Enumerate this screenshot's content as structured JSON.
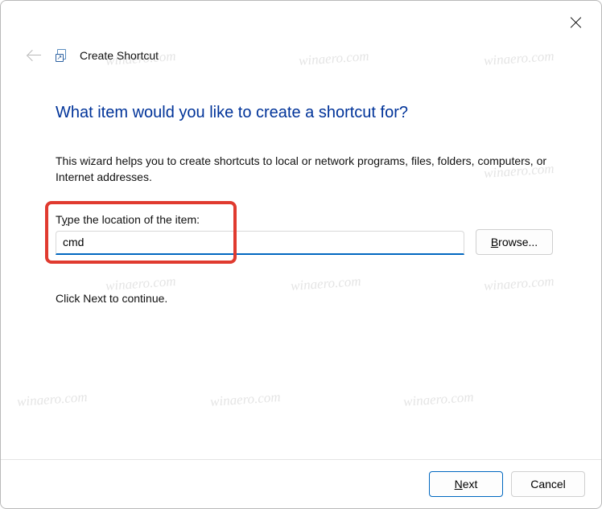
{
  "window": {
    "title": "Create Shortcut"
  },
  "headline": "What item would you like to create a shortcut for?",
  "description": "This wizard helps you to create shortcuts to local or network programs, files, folders, computers, or Internet addresses.",
  "field": {
    "label_pre": "T",
    "label_u": "y",
    "label_post": "pe the location of the item:",
    "value": "cmd"
  },
  "buttons": {
    "browse_u": "B",
    "browse_post": "rowse...",
    "next_u": "N",
    "next_post": "ext",
    "cancel": "Cancel"
  },
  "continue_text": "Click Next to continue.",
  "watermark": "winaero.com"
}
